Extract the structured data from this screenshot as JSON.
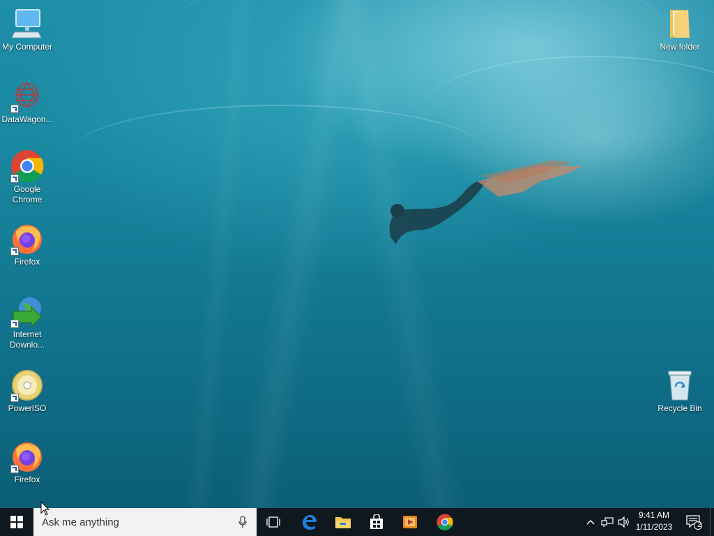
{
  "desktop": {
    "icons_left": [
      {
        "label": "My Computer"
      },
      {
        "label": "DataWagon..."
      },
      {
        "label": "Google Chrome"
      },
      {
        "label": "Firefox"
      },
      {
        "label": "Internet Downlo..."
      },
      {
        "label": "PowerISO"
      },
      {
        "label": "Firefox"
      }
    ],
    "icons_right": [
      {
        "label": "New folder"
      },
      {
        "label": "Recycle Bin"
      }
    ]
  },
  "taskbar": {
    "search_placeholder": "Ask me anything",
    "pinned": [
      "task-view-icon",
      "edge-icon",
      "file-explorer-icon",
      "store-icon",
      "media-player-icon",
      "chrome-icon"
    ],
    "clock": {
      "time": "9:41 AM",
      "date": "1/11/2023"
    },
    "notification_count": "2"
  },
  "colors": {
    "taskbar": "#10181f",
    "search_bg": "#f2f2f2",
    "accent": "#1f7fd6"
  }
}
